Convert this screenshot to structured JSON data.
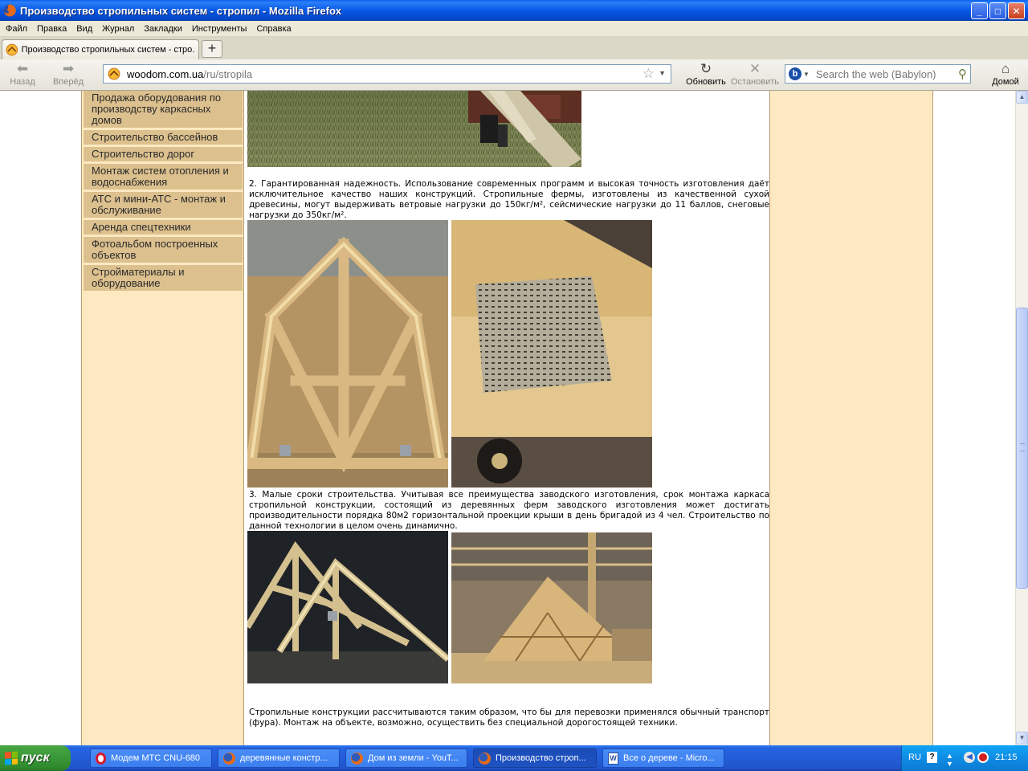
{
  "window": {
    "title": "Производство стропильных систем - стропил - Mozilla Firefox",
    "minimize": "_",
    "maximize": "□",
    "close": "✕"
  },
  "menu": [
    "Файл",
    "Правка",
    "Вид",
    "Журнал",
    "Закладки",
    "Инструменты",
    "Справка"
  ],
  "tab": {
    "label": "Производство стропильных систем - стро...",
    "new_tab": "+"
  },
  "nav": {
    "back": "Назад",
    "forward": "Вперёд",
    "reload": "Обновить",
    "stop": "Остановить",
    "home": "Домой",
    "url_domain": "woodom.com.ua",
    "url_path": "/ru/stropila",
    "search_placeholder": "Search the web (Babylon)"
  },
  "sidebar_menu": [
    "Продажа оборудования по производству каркасных домов",
    "Строительство бассейнов",
    "Строительство дорог",
    "Монтаж систем отопления и водоснабжения",
    "АТС и мини-АТС - монтаж и обслуживание",
    "Аренда спецтехники",
    "Фотоальбом построенных объектов",
    "Стройматериалы и оборудование"
  ],
  "content": {
    "para_reliability": "2. Гарантированная надежность. Использование современных программ и высокая точность изготовления даёт исключительное качество наших конструкций. Стропильные фермы, изготовлены из качественной сухой древесины, могут выдерживать ветровые нагрузки до 150кг/м², сейсмические нагрузки до 11 баллов, снеговые нагрузки до 350кг/м².",
    "para_speed": "3. Малые сроки строительства. Учитывая все преимущества заводского изготовления, срок монтажа каркаса стропильной конструкции, состоящий из деревянных ферм заводского изготовления может достигать производительности порядка 80м2 горизонтальной проекции крыши в день бригадой из 4 чел. Строительство по данной технологии в целом очень динамично.",
    "para_transport": "Стропильные конструкции рассчитываются таким образом, что бы для перевозки применялся обычный транспорт (фура). Монтаж на объекте, возможно, осуществить без специальной дорогостоящей техники."
  },
  "taskbar": {
    "start": "пуск",
    "items": [
      "Модем МТС CNU-680",
      "деревянные констр...",
      "Дом из земли - YouT...",
      "Производство строп...",
      "Все о дереве - Micro..."
    ],
    "lang": "RU",
    "clock": "21:15"
  },
  "colors": {
    "page_side": "#fde9c1",
    "menu_item": "#dcc08e",
    "xp_blue": "#245edb",
    "start_green": "#3c9a3a"
  }
}
